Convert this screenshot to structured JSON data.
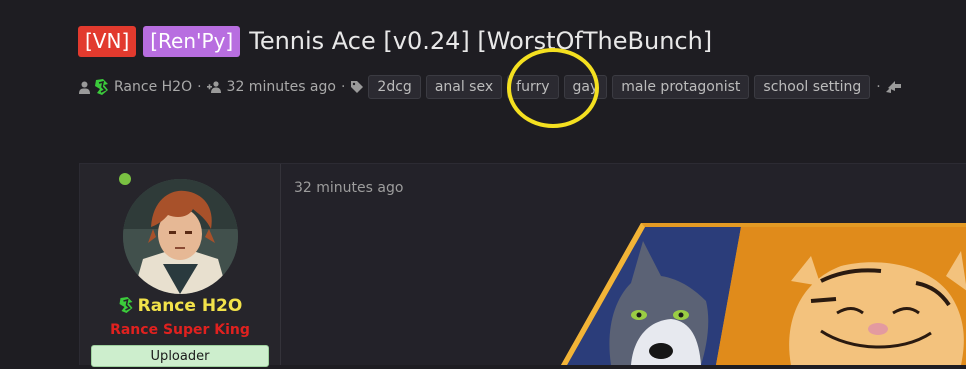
{
  "thread": {
    "prefix_vn": "[VN]",
    "prefix_engine": "[Ren'Py]",
    "title": "Tennis Ace [v0.24] [WorstOfTheBunch]"
  },
  "meta": {
    "author": "Rance H2O",
    "time_ago": "32 minutes ago",
    "tags": [
      "2dcg",
      "anal sex",
      "furry",
      "gay",
      "male protagonist",
      "school setting"
    ]
  },
  "post": {
    "time_ago": "32 minutes ago",
    "poster_name": "Rance H2O",
    "poster_role": "Rance Super King",
    "badge": "Uploader"
  },
  "colors": {
    "prefix_vn": "#e23a2e",
    "prefix_engine": "#b86ee0",
    "highlight": "#f4e020",
    "poster_name": "#f2e24a",
    "poster_role": "#e0211f",
    "online": "#7ac142",
    "badge_bg": "#cdeecd"
  },
  "icons": {
    "author": "user-icon",
    "time": "users-icon",
    "tags": "tag-icon",
    "extra": "share-arrows-icon",
    "brand": "brand-logo-icon"
  }
}
